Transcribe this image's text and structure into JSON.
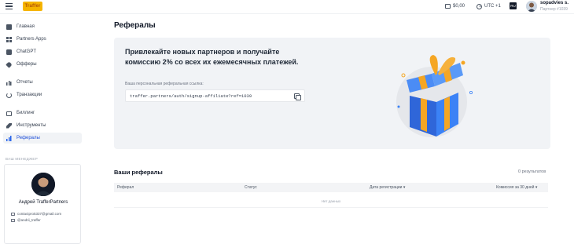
{
  "header": {
    "logo_text": "Traffer",
    "balance": "$0,00",
    "timezone": "UTC +1",
    "language": "RU",
    "user_name": "sopadvies s.",
    "user_partner": "Партнер #1039"
  },
  "sidebar": {
    "items": [
      {
        "label": "Главная",
        "icon": "home-icon"
      },
      {
        "label": "Partners Apps",
        "icon": "apps-grid-icon"
      },
      {
        "label": "ChatGPT",
        "icon": "chatgpt-icon"
      },
      {
        "label": "Офферы",
        "icon": "tag-icon"
      },
      {
        "label": "Отчеты",
        "icon": "bar-chart-icon"
      },
      {
        "label": "Транзакции",
        "icon": "transactions-icon"
      },
      {
        "label": "Биллинг",
        "icon": "credit-card-icon"
      },
      {
        "label": "Инструменты",
        "icon": "wrench-icon"
      },
      {
        "label": "Рефералы",
        "icon": "referrals-chart-icon"
      }
    ],
    "active_index": 8,
    "manager": {
      "section_label": "ВАШ МЕНЕДЖЕР",
      "name": "Андрей TrafferPartners",
      "email": "contactpro5337@gmail.com",
      "telegram": "@andrii_traffer"
    }
  },
  "main": {
    "page_title": "Рефералы",
    "promo": {
      "title": "Привлекайте новых партнеров и получайте комиссию 2% со всех их ежемесячных платежей.",
      "link_label": "Ваша персональная реферальная ссылка:",
      "link_value": "traffer.partners/auth/signup-affiliate?ref=1039"
    },
    "referrals": {
      "title": "Ваши рефералы",
      "results": "0  результатов",
      "columns": [
        "Реферал",
        "Статус",
        "Дата регистрации ▾",
        "Комиссия за 30 дней ▾"
      ],
      "empty_text": "Нет данных"
    }
  },
  "colors": {
    "accent": "#2563eb",
    "promo_bg": "#f1f3f6",
    "gift_blue": "#3b82f6",
    "gift_ribbon": "#f5a623"
  }
}
